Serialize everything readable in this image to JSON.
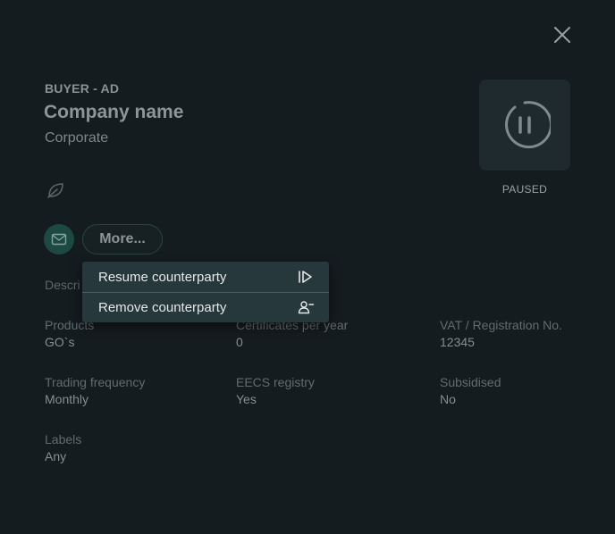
{
  "header": {
    "type_label": "BUYER - AD",
    "company_name": "Company name",
    "company_type": "Corporate"
  },
  "status": {
    "label": "PAUSED",
    "icon": "pause-icon"
  },
  "actions": {
    "more_label": "More...",
    "menu": [
      {
        "label": "Resume counterparty",
        "icon": "resume-icon"
      },
      {
        "label": "Remove counterparty",
        "icon": "remove-user-icon"
      }
    ]
  },
  "description": {
    "label": "Descri"
  },
  "fields": [
    {
      "label": "Products",
      "value": "GO`s"
    },
    {
      "label": "Certificates per year",
      "value": "0"
    },
    {
      "label": "VAT / Registration No.",
      "value": "12345"
    },
    {
      "label": "Trading frequency",
      "value": "Monthly"
    },
    {
      "label": "EECS registry",
      "value": "Yes"
    },
    {
      "label": "Subsidised",
      "value": "No"
    },
    {
      "label": "Labels",
      "value": "Any"
    }
  ],
  "colors": {
    "background": "#151c1f",
    "menu_background": "#27383d",
    "accent_green": "#1c4a42"
  }
}
